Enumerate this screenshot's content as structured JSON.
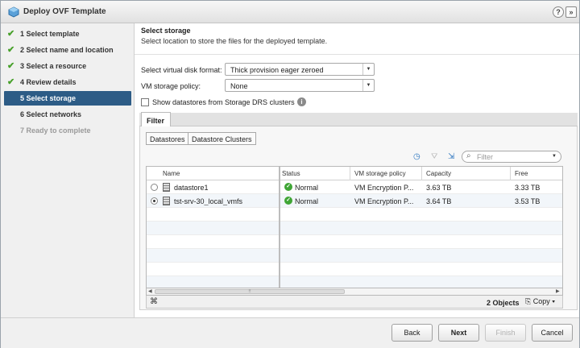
{
  "window": {
    "title": "Deploy OVF Template",
    "help_label": "?",
    "expand_label": "»"
  },
  "steps": [
    {
      "number": "1",
      "label": "Select template",
      "state": "done"
    },
    {
      "number": "2",
      "label": "Select name and location",
      "state": "done"
    },
    {
      "number": "3",
      "label": "Select a resource",
      "state": "done"
    },
    {
      "number": "4",
      "label": "Review details",
      "state": "done"
    },
    {
      "number": "5",
      "label": "Select storage",
      "state": "active"
    },
    {
      "number": "6",
      "label": "Select networks",
      "state": "todo"
    },
    {
      "number": "7",
      "label": "Ready to complete",
      "state": "disabled"
    }
  ],
  "main": {
    "heading": "Select storage",
    "subheading": "Select location to store the files for the deployed template.",
    "disk_format_label": "Select virtual disk format:",
    "disk_format_value": "Thick provision eager zeroed",
    "policy_label": "VM storage policy:",
    "policy_value": "None",
    "sdrs_label": "Show datastores from Storage DRS clusters",
    "tab_filter": "Filter",
    "seg_datastores": "Datastores",
    "seg_clusters": "Datastore Clusters",
    "filter_placeholder": "Filter"
  },
  "table": {
    "columns": [
      "Name",
      "Status",
      "VM storage policy",
      "Capacity",
      "Free"
    ],
    "rows": [
      {
        "name": "datastore1",
        "status": "Normal",
        "policy": "VM Encryption P...",
        "capacity": "3.63  TB",
        "free": "3.33  TB",
        "selected": false
      },
      {
        "name": "tst-srv-30_local_vmfs",
        "status": "Normal",
        "policy": "VM Encryption P...",
        "capacity": "3.64  TB",
        "free": "3.53  TB",
        "selected": true
      }
    ],
    "object_count": "2 Objects",
    "copy_label": "Copy"
  },
  "footer": {
    "back": "Back",
    "next": "Next",
    "finish": "Finish",
    "cancel": "Cancel"
  },
  "colors": {
    "active_step": "#2d5c86",
    "check": "#47a02a",
    "ok_status": "#3fa535"
  }
}
